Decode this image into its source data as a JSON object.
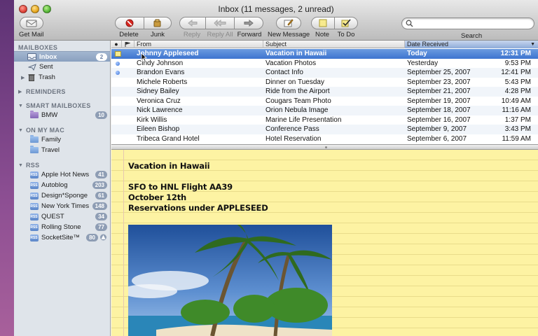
{
  "window": {
    "title": "Inbox (11 messages, 2 unread)"
  },
  "toolbar": {
    "get_mail": "Get Mail",
    "delete": "Delete",
    "junk": "Junk",
    "reply": "Reply",
    "reply_all": "Reply All",
    "forward": "Forward",
    "new_message": "New Message",
    "note": "Note",
    "to_do": "To Do",
    "search": "Search",
    "search_placeholder": ""
  },
  "sidebar": {
    "mailboxes_header": "MAILBOXES",
    "mailboxes": [
      {
        "label": "Inbox",
        "badge": "2"
      },
      {
        "label": "Sent",
        "badge": ""
      },
      {
        "label": "Trash",
        "badge": ""
      }
    ],
    "reminders_header": "REMINDERS",
    "smart_header": "SMART MAILBOXES",
    "smart": [
      {
        "label": "BMW",
        "badge": "10"
      }
    ],
    "mac_header": "ON MY MAC",
    "mac": [
      {
        "label": "Family"
      },
      {
        "label": "Travel"
      }
    ],
    "rss_header": "RSS",
    "rss": [
      {
        "label": "Apple Hot News",
        "badge": "41"
      },
      {
        "label": "Autoblog",
        "badge": "203"
      },
      {
        "label": "Design*Sponge",
        "badge": "61"
      },
      {
        "label": "New York Times",
        "badge": "148"
      },
      {
        "label": "QUEST",
        "badge": "34"
      },
      {
        "label": "Rolling Stone",
        "badge": "77"
      },
      {
        "label": "SocketSite™",
        "badge": "80"
      }
    ],
    "rss_icon_text": "RSS"
  },
  "list": {
    "columns": {
      "from": "From",
      "subject": "Subject",
      "date": "Date Received"
    },
    "rows": [
      {
        "from": "Johnny Appleseed",
        "subject": "Vacation in Hawaii",
        "date": "Today",
        "time": "12:31 PM",
        "unread": false
      },
      {
        "from": "Cindy Johnson",
        "subject": "Vacation Photos",
        "date": "Yesterday",
        "time": "9:53 PM",
        "unread": true
      },
      {
        "from": "Brandon Evans",
        "subject": "Contact Info",
        "date": "September 25, 2007",
        "time": "12:41 PM",
        "unread": true
      },
      {
        "from": "Michele Roberts",
        "subject": "Dinner on Tuesday",
        "date": "September 23, 2007",
        "time": "5:43 PM",
        "unread": false
      },
      {
        "from": "Sidney Bailey",
        "subject": "Ride from the Airport",
        "date": "September 21, 2007",
        "time": "4:28 PM",
        "unread": false
      },
      {
        "from": "Veronica Cruz",
        "subject": "Cougars Team Photo",
        "date": "September 19, 2007",
        "time": "10:49 AM",
        "unread": false
      },
      {
        "from": "Nick Lawrence",
        "subject": "Orion Nebula Image",
        "date": "September 18, 2007",
        "time": "11:16 AM",
        "unread": false
      },
      {
        "from": "Kirk Willis",
        "subject": "Marine Life Presentation",
        "date": "September 16, 2007",
        "time": "1:37 PM",
        "unread": false
      },
      {
        "from": "Eileen Bishop",
        "subject": "Conference Pass",
        "date": "September 9, 2007",
        "time": "3:43 PM",
        "unread": false
      },
      {
        "from": "Tribeca Grand Hotel",
        "subject": "Hotel Reservation",
        "date": "September 6, 2007",
        "time": "11:59 AM",
        "unread": false
      }
    ]
  },
  "note": {
    "title": "Vacation in Hawaii",
    "line1": "SFO to HNL Flight AA39",
    "line2": "October 12th",
    "line3": "Reservations under APPLESEED"
  }
}
